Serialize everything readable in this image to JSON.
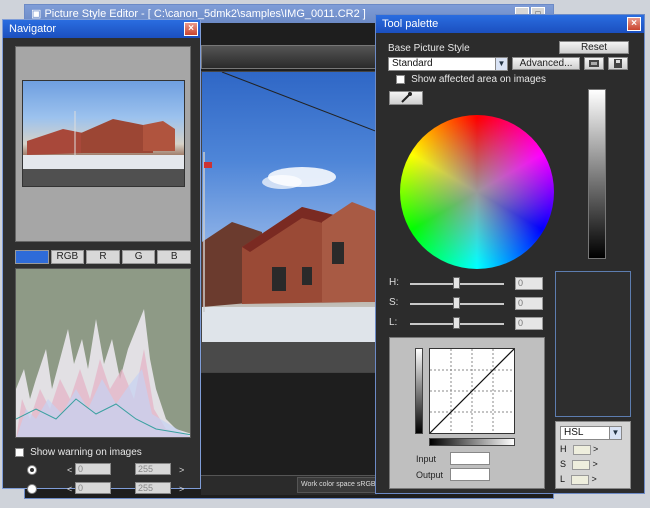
{
  "main_window": {
    "title": "Picture Style Editor - [ C:\\canon_5dmk2\\samples\\IMG_0011.CR2 ]",
    "work_color_space_label": "Work color space",
    "work_color_space_value": "sRGB"
  },
  "navigator": {
    "title": "Navigator",
    "close_label": "×",
    "tabs": [
      "",
      "RGB",
      "R",
      "G",
      "B"
    ],
    "active_tab": 0,
    "show_warning_label": "Show warning on images",
    "row1": {
      "low": "0",
      "high": "255"
    },
    "row2": {
      "low": "0",
      "high": "255"
    },
    "lt": "<",
    "gt": ">"
  },
  "tool_palette": {
    "title": "Tool palette",
    "close_label": "×",
    "base_label": "Base Picture Style",
    "reset_label": "Reset",
    "base_style": "Standard",
    "advanced_label": "Advanced...",
    "show_affected_label": "Show affected area on images",
    "sliders": [
      {
        "label": "H:",
        "value": "0",
        "knob_pct": 50
      },
      {
        "label": "S:",
        "value": "0",
        "knob_pct": 50
      },
      {
        "label": "L:",
        "value": "0",
        "knob_pct": 50
      }
    ],
    "input_label": "Input",
    "output_label": "Output",
    "mode": "HSL",
    "hsl_rows": [
      {
        "label": "H",
        "arrow": ">"
      },
      {
        "label": "S",
        "arrow": ">"
      },
      {
        "label": "L",
        "arrow": ">"
      }
    ]
  },
  "colors": {
    "title_active": "#2a6de0",
    "title_inactive": "#7f9dd8",
    "panel_bg": "#2c2c2c",
    "tab_active": "#2e6bd8"
  },
  "icons": [
    "eyedropper-icon",
    "open-file-icon",
    "save-icon",
    "dropdown-arrow-icon",
    "close-icon"
  ]
}
